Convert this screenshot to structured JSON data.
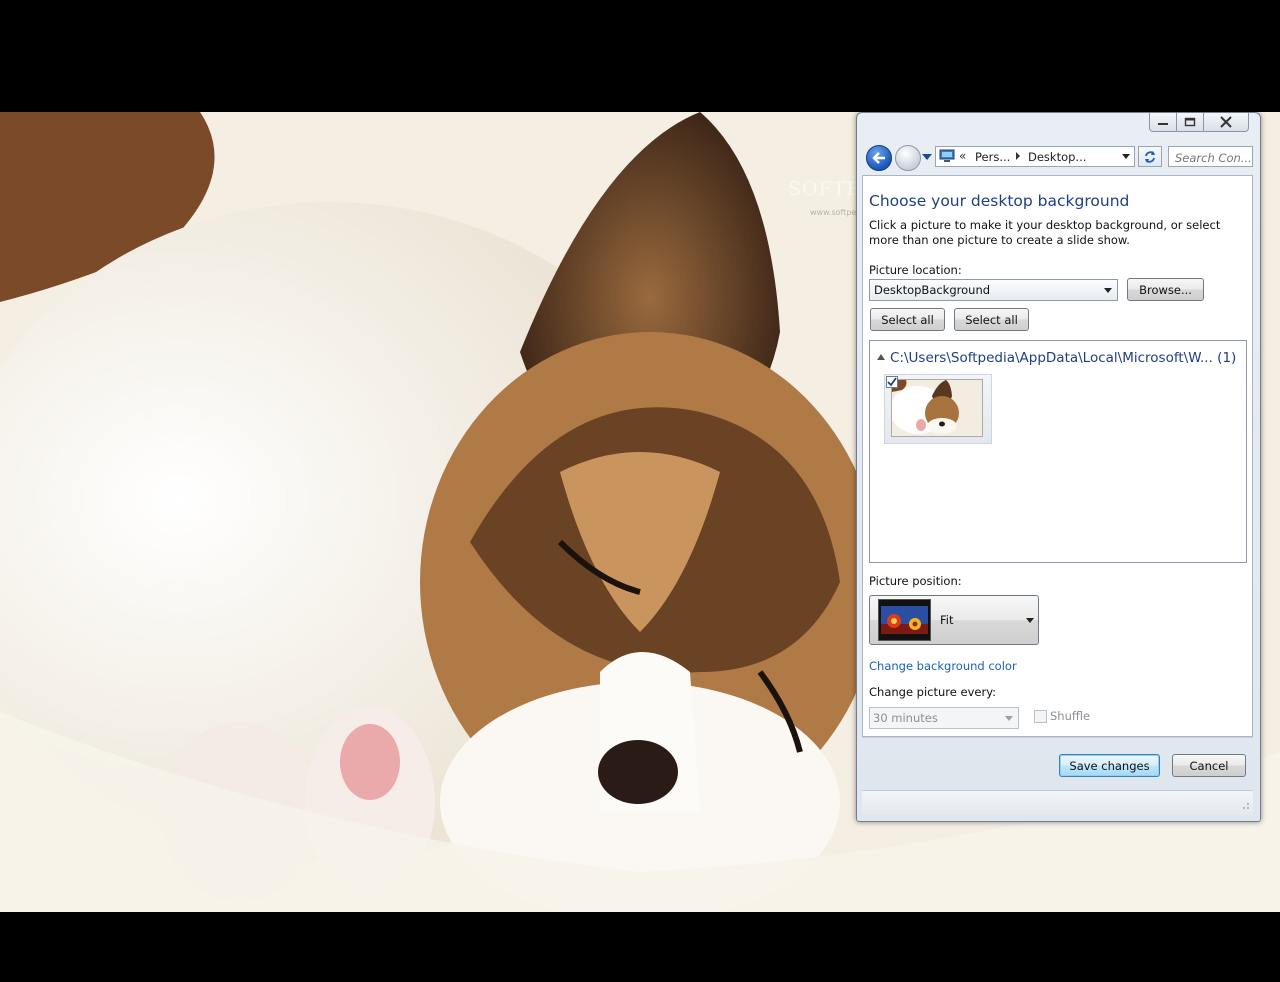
{
  "watermark": {
    "brand": "SOFTPEDIA",
    "url": "www.softpedia.com"
  },
  "window": {
    "caption_buttons": [
      "minimize-icon",
      "maximize-icon",
      "close-icon"
    ],
    "address": {
      "chevron": "«",
      "segment1": "Pers...",
      "segment2": "Desktop..."
    },
    "search_placeholder": "Search Con..."
  },
  "page": {
    "title": "Choose your desktop background",
    "description": "Click a picture to make it your desktop background, or select more than one picture to create a slide show.",
    "picture_location_label": "Picture location:",
    "picture_location_value": "DesktopBackground",
    "browse_label": "Browse...",
    "select_all_1": "Select all",
    "select_all_2": "Select all",
    "group_header": "C:\\Users\\Softpedia\\AppData\\Local\\Microsoft\\W... (1)",
    "thumbnail_checked": true,
    "picture_position_label": "Picture position:",
    "picture_position_value": "Fit",
    "change_bg_color_link": "Change background color",
    "change_every_label": "Change picture every:",
    "change_every_value": "30 minutes",
    "shuffle_label": "Shuffle",
    "shuffle_checked": false,
    "save_label": "Save changes",
    "cancel_label": "Cancel"
  },
  "colors": {
    "title_blue": "#1e3f85",
    "link_blue": "#1a62b8",
    "save_button_blue": "#a7d9f5"
  }
}
